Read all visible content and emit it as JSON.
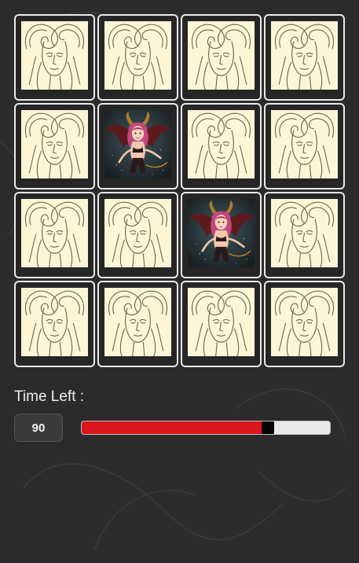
{
  "board": {
    "cards": [
      {
        "state": "hidden",
        "image": "sketched-horned-woman-card-back"
      },
      {
        "state": "hidden",
        "image": "sketched-horned-woman-card-back"
      },
      {
        "state": "hidden",
        "image": "sketched-horned-woman-card-back"
      },
      {
        "state": "hidden",
        "image": "sketched-horned-woman-card-back"
      },
      {
        "state": "hidden",
        "image": "sketched-horned-woman-card-back"
      },
      {
        "state": "revealed",
        "image": "winged-demon-girl-illustration"
      },
      {
        "state": "hidden",
        "image": "sketched-horned-woman-card-back"
      },
      {
        "state": "hidden",
        "image": "sketched-horned-woman-card-back"
      },
      {
        "state": "hidden",
        "image": "sketched-horned-woman-card-back"
      },
      {
        "state": "hidden",
        "image": "sketched-horned-woman-card-back"
      },
      {
        "state": "revealed",
        "image": "winged-demon-girl-illustration"
      },
      {
        "state": "hidden",
        "image": "sketched-horned-woman-card-back"
      },
      {
        "state": "hidden",
        "image": "sketched-horned-woman-card-back"
      },
      {
        "state": "hidden",
        "image": "sketched-horned-woman-card-back"
      },
      {
        "state": "hidden",
        "image": "sketched-horned-woman-card-back"
      },
      {
        "state": "hidden",
        "image": "sketched-horned-woman-card-back"
      }
    ]
  },
  "timer": {
    "label": "Time Left :",
    "value": "90",
    "fraction_remaining": 0.75
  },
  "colors": {
    "background": "#2b2b2b",
    "card_back_paper": "#fdf6d5",
    "progress_fill": "#d9151d",
    "progress_track": "#e8e8e8"
  }
}
